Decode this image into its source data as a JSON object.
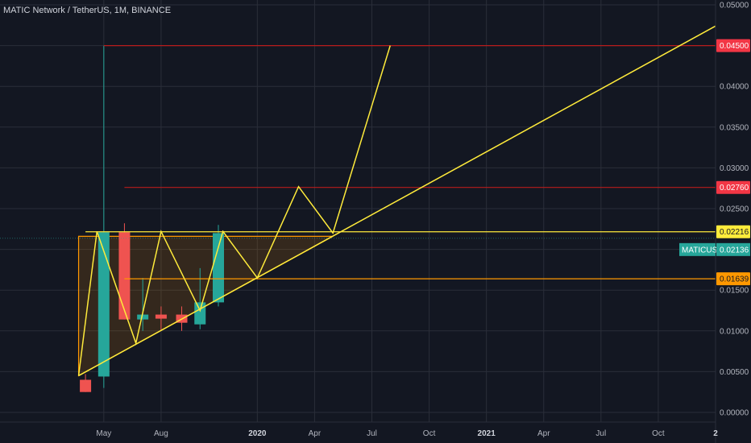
{
  "chart_data": {
    "type": "candlestick",
    "title": "MATIC Network / TetherUS, 1M, BINANCE",
    "symbol_tag": "MATICUSDT",
    "current_price": "0.02136",
    "ylim": [
      -0.0005,
      0.05
    ],
    "y_ticks": [
      "0.00000",
      "0.00500",
      "0.01000",
      "0.01500",
      "0.02000",
      "0.02500",
      "0.03000",
      "0.03500",
      "0.04000",
      "0.04500",
      "0.05000"
    ],
    "x_ticks": [
      {
        "label": "May",
        "year": 2019.33,
        "bold": false
      },
      {
        "label": "Aug",
        "year": 2019.58,
        "bold": false
      },
      {
        "label": "2020",
        "year": 2020.0,
        "bold": true
      },
      {
        "label": "Apr",
        "year": 2020.25,
        "bold": false
      },
      {
        "label": "Jul",
        "year": 2020.5,
        "bold": false
      },
      {
        "label": "Oct",
        "year": 2020.75,
        "bold": false
      },
      {
        "label": "2021",
        "year": 2021.0,
        "bold": true
      },
      {
        "label": "Apr",
        "year": 2021.25,
        "bold": false
      },
      {
        "label": "Jul",
        "year": 2021.5,
        "bold": false
      },
      {
        "label": "Oct",
        "year": 2021.75,
        "bold": false
      },
      {
        "label": "2",
        "year": 2022.0,
        "bold": true
      }
    ],
    "xlim": [
      2018.98,
      2022.0
    ],
    "candles": [
      {
        "month": "2019-04",
        "t": 2019.25,
        "open": 0.004,
        "high": 0.0047,
        "low": 0.0025,
        "close": 0.0025
      },
      {
        "month": "2019-05",
        "t": 2019.33,
        "open": 0.0044,
        "high": 0.045,
        "low": 0.003,
        "close": 0.0221
      },
      {
        "month": "2019-06",
        "t": 2019.42,
        "open": 0.0221,
        "high": 0.0232,
        "low": 0.0114,
        "close": 0.0114
      },
      {
        "month": "2019-07",
        "t": 2019.5,
        "open": 0.0114,
        "high": 0.0165,
        "low": 0.01,
        "close": 0.012
      },
      {
        "month": "2019-08",
        "t": 2019.58,
        "open": 0.012,
        "high": 0.013,
        "low": 0.01,
        "close": 0.0115
      },
      {
        "month": "2019-09",
        "t": 2019.67,
        "open": 0.012,
        "high": 0.013,
        "low": 0.01,
        "close": 0.011
      },
      {
        "month": "2019-10",
        "t": 2019.75,
        "open": 0.0108,
        "high": 0.0177,
        "low": 0.0102,
        "close": 0.0135
      },
      {
        "month": "2019-11",
        "t": 2019.83,
        "open": 0.0135,
        "high": 0.023,
        "low": 0.013,
        "close": 0.022
      }
    ],
    "levels": [
      {
        "value": "0.04500",
        "color": "#b71c1c",
        "tag_bg": "#f23645",
        "tag_fg": "#ffffff",
        "from_t": 2019.33
      },
      {
        "value": "0.02760",
        "color": "#b71c1c",
        "tag_bg": "#f23645",
        "tag_fg": "#ffffff",
        "from_t": 2019.42
      },
      {
        "value": "0.02216",
        "color": "#ffeb3b",
        "tag_bg": "#ffeb3b",
        "tag_fg": "#131722",
        "from_t": 2019.25
      },
      {
        "value": "0.01639",
        "color": "#ff9800",
        "tag_bg": "#ff9800",
        "tag_fg": "#131722",
        "from_t": 2019.42
      }
    ],
    "colors": {
      "up": "#26a69a",
      "down": "#ef5350",
      "background": "#131722",
      "grid": "#2a2e39",
      "trendline": "#ffeb3b",
      "triangle": "#ff9800",
      "last_price_line": "#26a69a"
    },
    "zigzag": [
      [
        2019.22,
        0.0045
      ],
      [
        2019.3,
        0.0222
      ],
      [
        2019.47,
        0.0085
      ],
      [
        2019.58,
        0.0222
      ],
      [
        2019.75,
        0.0125
      ],
      [
        2019.85,
        0.0222
      ],
      [
        2020.0,
        0.0165
      ],
      [
        2020.18,
        0.0277
      ],
      [
        2020.33,
        0.022
      ],
      [
        2020.58,
        0.045
      ]
    ],
    "trendline": [
      [
        2019.22,
        0.0045
      ],
      [
        2022.0,
        0.0474
      ]
    ],
    "triangle": [
      [
        2019.22,
        0.0045
      ],
      [
        2019.22,
        0.0216
      ],
      [
        2020.33,
        0.0216
      ]
    ]
  }
}
